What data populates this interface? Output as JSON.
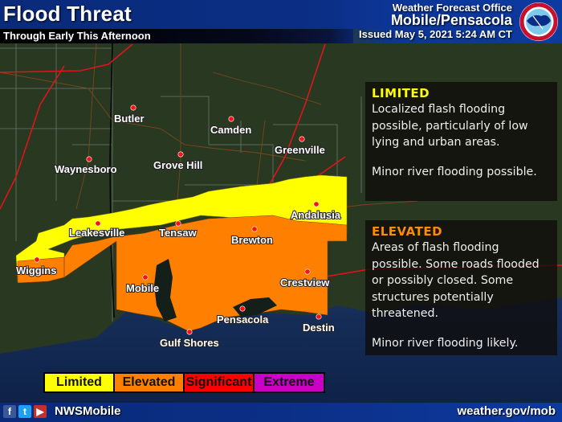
{
  "header": {
    "title": "Flood Threat",
    "subtitle": "Through Early This Afternoon",
    "office_line1": "Weather Forecast Office",
    "office_line2": "Mobile/Pensacola",
    "issued": "Issued May 5, 2021 5:24 AM CT",
    "logo": "nws-logo-icon"
  },
  "panels": [
    {
      "level": "LIMITED",
      "color": "#ffff00",
      "text1": "Localized flash flooding possible, particularly of low lying and urban areas.",
      "text2": "Minor river flooding possible."
    },
    {
      "level": "ELEVATED",
      "color": "#ff8c00",
      "text1": "Areas of flash flooding possible. Some roads flooded or possibly closed. Some structures potentially threatened.",
      "text2": "Minor river flooding likely."
    }
  ],
  "legend": [
    {
      "label": "Limited",
      "color": "#ffff00"
    },
    {
      "label": "Elevated",
      "color": "#ff8000"
    },
    {
      "label": "Significant",
      "color": "#ff0000"
    },
    {
      "label": "Extreme",
      "color": "#c800c8"
    }
  ],
  "cities": [
    {
      "name": "Butler"
    },
    {
      "name": "Camden"
    },
    {
      "name": "Greenville"
    },
    {
      "name": "Waynesboro"
    },
    {
      "name": "Grove Hill"
    },
    {
      "name": "Leakesville"
    },
    {
      "name": "Tensaw"
    },
    {
      "name": "Andalusia"
    },
    {
      "name": "Brewton"
    },
    {
      "name": "Wiggins"
    },
    {
      "name": "Mobile"
    },
    {
      "name": "Crestview"
    },
    {
      "name": "Pensacola"
    },
    {
      "name": "Destin"
    },
    {
      "name": "Gulf Shores"
    }
  ],
  "footer": {
    "social": [
      "facebook-icon",
      "twitter-icon",
      "youtube-icon"
    ],
    "handle": "NWSMobile",
    "url": "weather.gov/mob"
  }
}
